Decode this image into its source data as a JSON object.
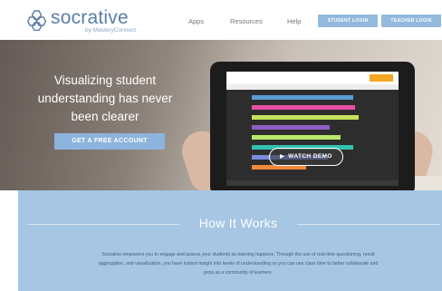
{
  "header": {
    "logo_text": "socrative",
    "logo_sub": "by MasteryConnect",
    "nav": {
      "apps": "Apps",
      "resources": "Resources",
      "help": "Help"
    },
    "student_login": "STUDENT LOGIN",
    "teacher_login": "TEACHER LOGIN"
  },
  "hero": {
    "title": "Visualizing student understanding has never been clearer",
    "cta": "GET A FREE ACCOUNT",
    "watch_demo": "WATCH DEMO"
  },
  "how": {
    "title": "How It Works",
    "text": "Socrative empowers you to engage and assess your students as learning happens. Through the use of real-time questioning, result aggregation, and visualization, you have instant insight into levels of understanding so you can use class time to better collaborate and grow as a community of learners."
  },
  "colors": {
    "brand_blue": "#5a7fa8",
    "button_blue": "#93b9dc",
    "how_bg": "#a6c6e4",
    "accent_orange": "#f5a623"
  },
  "tablet_bars": {
    "colors": [
      "#5b9bd5",
      "#e94fa5",
      "#c7e35a",
      "#8f5fc4",
      "#b8e86a",
      "#33c1b2",
      "#7a8be0",
      "#f08a3a"
    ]
  }
}
